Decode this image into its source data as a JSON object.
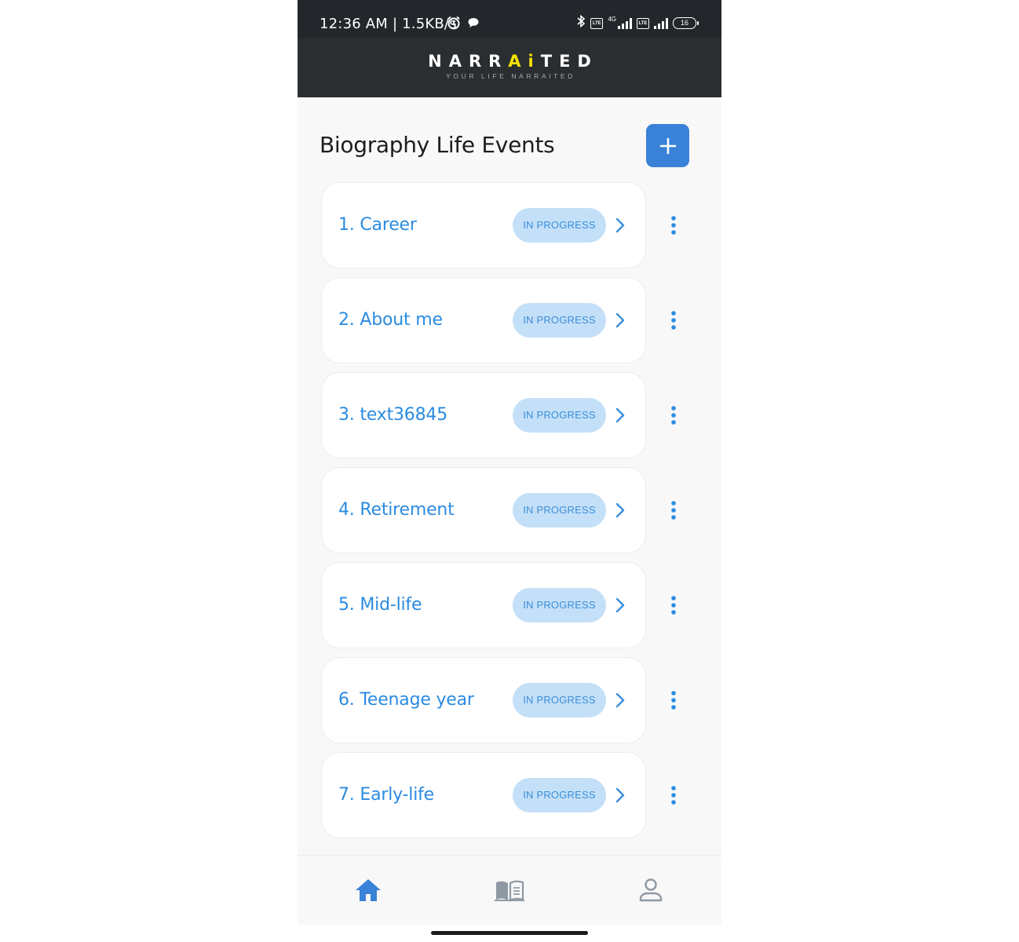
{
  "status_bar": {
    "time": "12:36 AM | 1.5KB/s",
    "network_label": "4G",
    "volte_label": "Vo\nLTE",
    "battery": "16"
  },
  "header": {
    "brand_part1": "NARR",
    "brand_ai": "Ai",
    "brand_part2": "TED",
    "tagline": "YOUR LIFE NARRAITED"
  },
  "page": {
    "title": "Biography Life Events"
  },
  "events": [
    {
      "title": "1. Career",
      "status": "IN PROGRESS"
    },
    {
      "title": "2. About me",
      "status": "IN PROGRESS"
    },
    {
      "title": "3. text36845",
      "status": "IN PROGRESS"
    },
    {
      "title": "4. Retirement",
      "status": "IN PROGRESS"
    },
    {
      "title": "5. Mid-life",
      "status": "IN PROGRESS"
    },
    {
      "title": "6. Teenage year",
      "status": "IN PROGRESS"
    },
    {
      "title": "7. Early-life",
      "status": "IN PROGRESS"
    }
  ],
  "nav": {
    "items": [
      "home-icon",
      "book-icon",
      "profile-icon"
    ],
    "active": "home-icon"
  },
  "colors": {
    "accent": "#3a82d8",
    "event_text": "#2b8be0",
    "badge_bg": "#c4e0f8",
    "header_bg": "#2a2e31",
    "brand_ai": "#f4e300"
  }
}
